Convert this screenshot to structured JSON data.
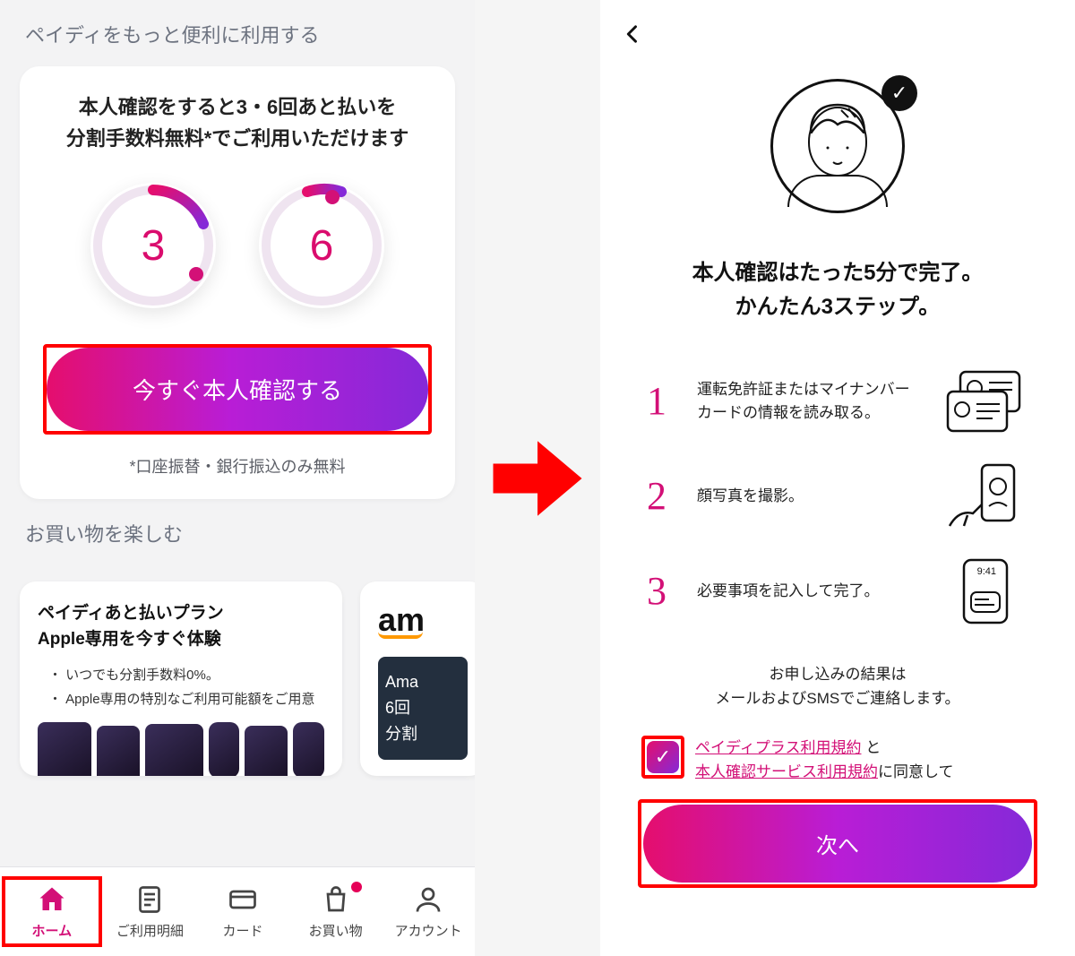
{
  "colors": {
    "brand_gradient_start": "#e50e6d",
    "brand_gradient_end": "#8529d8",
    "accent_pink": "#d31077",
    "highlight_red": "#ff0000"
  },
  "left": {
    "section_title": "ペイディをもっと便利に利用する",
    "card": {
      "heading_line1": "本人確認をすると3・6回あと払いを",
      "heading_line2": "分割手数料無料*でご利用いただけます",
      "circle_left": "3",
      "circle_right": "6",
      "cta_label": "今すぐ本人確認する",
      "footnote": "*口座振替・銀行振込のみ無料"
    },
    "shop_section_title": "お買い物を楽しむ",
    "promo_apple": {
      "title_line1": "ペイディあと払いプラン",
      "title_line2": "Apple専用を今すぐ体験",
      "bullet1": "・ いつでも分割手数料0%。",
      "bullet2": "・ Apple専用の特別なご利用可能額をご用意"
    },
    "promo_amazon": {
      "logo_text": "am",
      "dark_line1": "Ama",
      "dark_line2": "6回",
      "dark_line3": "分割"
    },
    "tabs": {
      "home": "ホーム",
      "history": "ご利用明細",
      "card": "カード",
      "shop": "お買い物",
      "account": "アカウント"
    }
  },
  "right": {
    "heading_line1": "本人確認はたった5分で完了。",
    "heading_line2": "かんたん3ステップ。",
    "steps": [
      {
        "num": "1",
        "text": "運転免許証またはマイナンバーカードの情報を読み取る。"
      },
      {
        "num": "2",
        "text": "顔写真を撮影。"
      },
      {
        "num": "3",
        "text": "必要事項を記入して完了。",
        "icon_time": "9:41"
      }
    ],
    "result_note_line1": "お申し込みの結果は",
    "result_note_line2": "メールおよびSMSでご連絡します。",
    "consent": {
      "link1": "ペイディプラス利用規約",
      "conj1": " と",
      "link2": "本人確認サービス利用規約",
      "tail": "に同意して"
    },
    "next_label": "次へ"
  }
}
